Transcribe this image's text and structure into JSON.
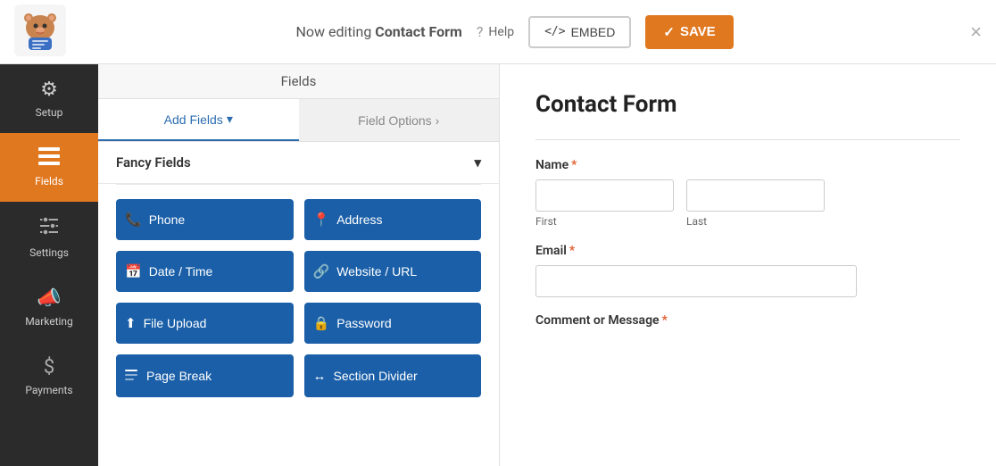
{
  "topbar": {
    "title_prefix": "Now editing ",
    "title_bold": "Contact Form",
    "help_label": "Help",
    "embed_label": "EMBED",
    "save_label": "SAVE",
    "close_icon": "×"
  },
  "sidebar": {
    "items": [
      {
        "id": "setup",
        "label": "Setup",
        "icon": "⚙",
        "active": false
      },
      {
        "id": "fields",
        "label": "Fields",
        "icon": "≡",
        "active": true
      },
      {
        "id": "settings",
        "label": "Settings",
        "icon": "⚏",
        "active": false
      },
      {
        "id": "marketing",
        "label": "Marketing",
        "icon": "📣",
        "active": false
      },
      {
        "id": "payments",
        "label": "Payments",
        "icon": "$",
        "active": false
      }
    ]
  },
  "fields_panel": {
    "header": "Fields",
    "tab_add": "Add Fields",
    "tab_options": "Field Options",
    "fancy_fields_label": "Fancy Fields",
    "buttons": [
      {
        "id": "phone",
        "label": "Phone",
        "icon": "📞"
      },
      {
        "id": "address",
        "label": "Address",
        "icon": "📍"
      },
      {
        "id": "datetime",
        "label": "Date / Time",
        "icon": "📅"
      },
      {
        "id": "website",
        "label": "Website / URL",
        "icon": "🔗"
      },
      {
        "id": "fileupload",
        "label": "File Upload",
        "icon": "⬆"
      },
      {
        "id": "password",
        "label": "Password",
        "icon": "🔒"
      },
      {
        "id": "pagebreak",
        "label": "Page Break",
        "icon": "📄"
      },
      {
        "id": "sectiondivider",
        "label": "Section Divider",
        "icon": "↔"
      }
    ]
  },
  "form_preview": {
    "title": "Contact Form",
    "fields": [
      {
        "id": "name",
        "label": "Name",
        "required": true,
        "type": "name",
        "subfields": [
          {
            "id": "first",
            "placeholder": "",
            "sublabel": "First"
          },
          {
            "id": "last",
            "placeholder": "",
            "sublabel": "Last"
          }
        ]
      },
      {
        "id": "email",
        "label": "Email",
        "required": true,
        "type": "email"
      },
      {
        "id": "comment",
        "label": "Comment or Message",
        "required": true,
        "type": "textarea"
      }
    ]
  }
}
